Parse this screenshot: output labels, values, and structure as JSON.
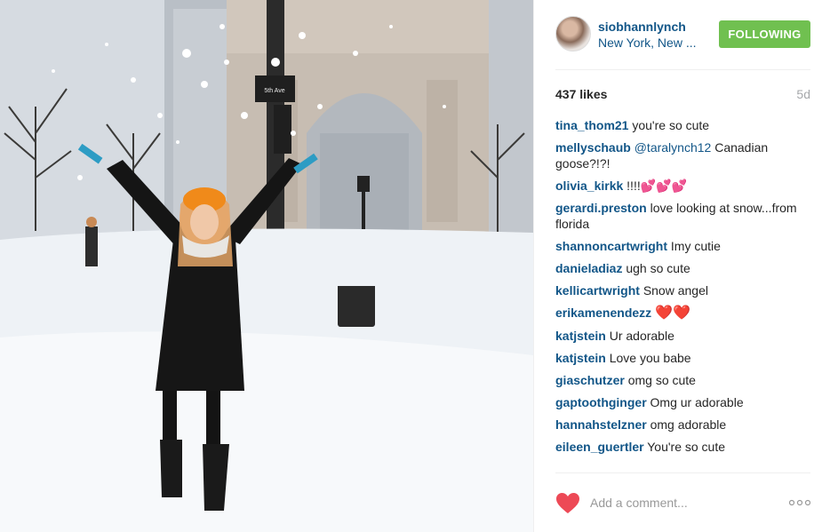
{
  "post": {
    "username": "siobhannlynch",
    "location": "New York, New ...",
    "follow_label": "FOLLOWING",
    "likes": "437 likes",
    "age": "5d"
  },
  "comments": [
    {
      "user": "tina_thom21",
      "text": "you're so cute"
    },
    {
      "user": "mellyschaub",
      "mention": "@taralynch12",
      "text": " Canadian goose?!?!"
    },
    {
      "user": "olivia_kirkk",
      "text": "!!!!",
      "emoji": "💕💕💕"
    },
    {
      "user": "gerardi.preston",
      "text": "love looking at snow...from florida"
    },
    {
      "user": "shannoncartwright",
      "text": "Imy cutie"
    },
    {
      "user": "danieladiaz",
      "text": "ugh so cute"
    },
    {
      "user": "kellicartwright",
      "text": "Snow angel"
    },
    {
      "user": "erikamenendezz",
      "text": "",
      "emoji": "❤️❤️"
    },
    {
      "user": "katjstein",
      "text": "Ur adorable"
    },
    {
      "user": "katjstein",
      "text": "Love you babe"
    },
    {
      "user": "giaschutzer",
      "text": "omg so cute"
    },
    {
      "user": "gaptoothginger",
      "text": "Omg ur adorable"
    },
    {
      "user": "hannahstelzner",
      "text": "omg adorable"
    },
    {
      "user": "eileen_guertler",
      "text": "You're so cute"
    }
  ],
  "footer": {
    "comment_placeholder": "Add a comment...",
    "like_icon": "heart-icon",
    "more_icon": "more-options-icon"
  },
  "colors": {
    "link": "#125688",
    "follow_button": "#70c050",
    "heart": "#ed4956"
  },
  "photo": {
    "sign_text": "5th Ave"
  }
}
